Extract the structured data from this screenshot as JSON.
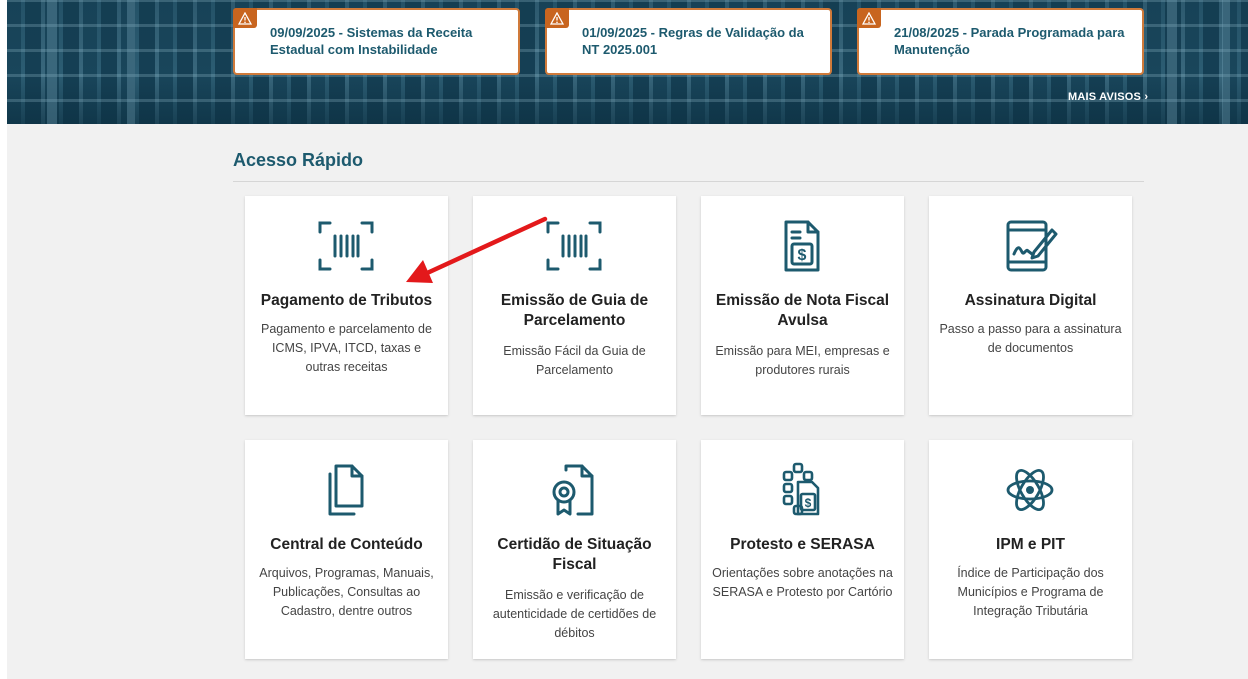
{
  "notices": [
    {
      "text": "09/09/2025 - Sistemas da Receita Estadual com Instabilidade"
    },
    {
      "text": "01/09/2025 - Regras de Validação da NT 2025.001"
    },
    {
      "text": "21/08/2025 - Parada Programada para Manutenção"
    }
  ],
  "more_notices": "MAIS AVISOS ›",
  "quick_access": {
    "title": "Acesso Rápido",
    "cards": [
      {
        "title": "Pagamento de Tributos",
        "desc": "Pagamento e parcelamento de ICMS, IPVA, ITCD, taxas e outras receitas",
        "icon": "barcode-icon"
      },
      {
        "title": "Emissão de Guia de Parcelamento",
        "desc": "Emissão Fácil da Guia de Parcelamento",
        "icon": "barcode-icon"
      },
      {
        "title": "Emissão de Nota Fiscal Avulsa",
        "desc": "Emissão para MEI, empresas e produtores rurais",
        "icon": "invoice-dollar-icon"
      },
      {
        "title": "Assinatura Digital",
        "desc": "Passo a passo para a assinatura de documentos",
        "icon": "tablet-signature-icon"
      },
      {
        "title": "Central de Conteúdo",
        "desc": "Arquivos, Programas, Manuais, Publicações, Consultas ao Cadastro, dentre outros",
        "icon": "documents-icon"
      },
      {
        "title": "Certidão de Situação Fiscal",
        "desc": "Emissão e verificação de autenticidade de certidões de débitos",
        "icon": "certificate-icon"
      },
      {
        "title": "Protesto e SERASA",
        "desc": "Orientações sobre anotações na SERASA e Protesto por Cartório",
        "icon": "protest-dollar-icon"
      },
      {
        "title": "IPM e PIT",
        "desc": "Índice de Participação dos Municípios e Programa de Integração Tributária",
        "icon": "atom-icon"
      }
    ]
  },
  "colors": {
    "accent": "#1d5a6e",
    "warning": "#c8651f",
    "arrow": "#e3191b"
  }
}
